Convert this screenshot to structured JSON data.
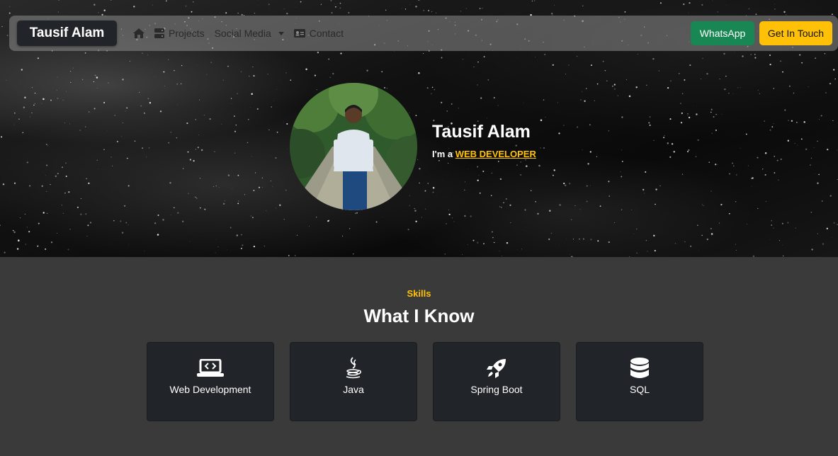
{
  "navbar": {
    "brand": "Tausif Alam",
    "links": [
      {
        "label": "",
        "icon": "home-icon"
      },
      {
        "label": "Projects",
        "icon": "server-icon"
      },
      {
        "label": "Social Media",
        "icon": "chevron-down-icon"
      },
      {
        "label": "Contact",
        "icon": "id-card-icon"
      }
    ],
    "whatsapp_label": "WhatsApp",
    "get_in_touch_label": "Get In Touch"
  },
  "hero": {
    "name": "Tausif Alam",
    "tagline_prefix": "I'm a ",
    "role": "WEB DEVELOPER"
  },
  "skills": {
    "kicker": "Skills",
    "title": "What I Know",
    "items": [
      {
        "label": "Web Development",
        "icon": "laptop-code-icon"
      },
      {
        "label": "Java",
        "icon": "java-icon"
      },
      {
        "label": "Spring Boot",
        "icon": "rocket-icon"
      },
      {
        "label": "SQL",
        "icon": "database-icon"
      }
    ]
  },
  "colors": {
    "accent": "#ffc107",
    "whatsapp": "#198754",
    "card_bg": "#212529",
    "section_bg": "#3a3a3a"
  }
}
